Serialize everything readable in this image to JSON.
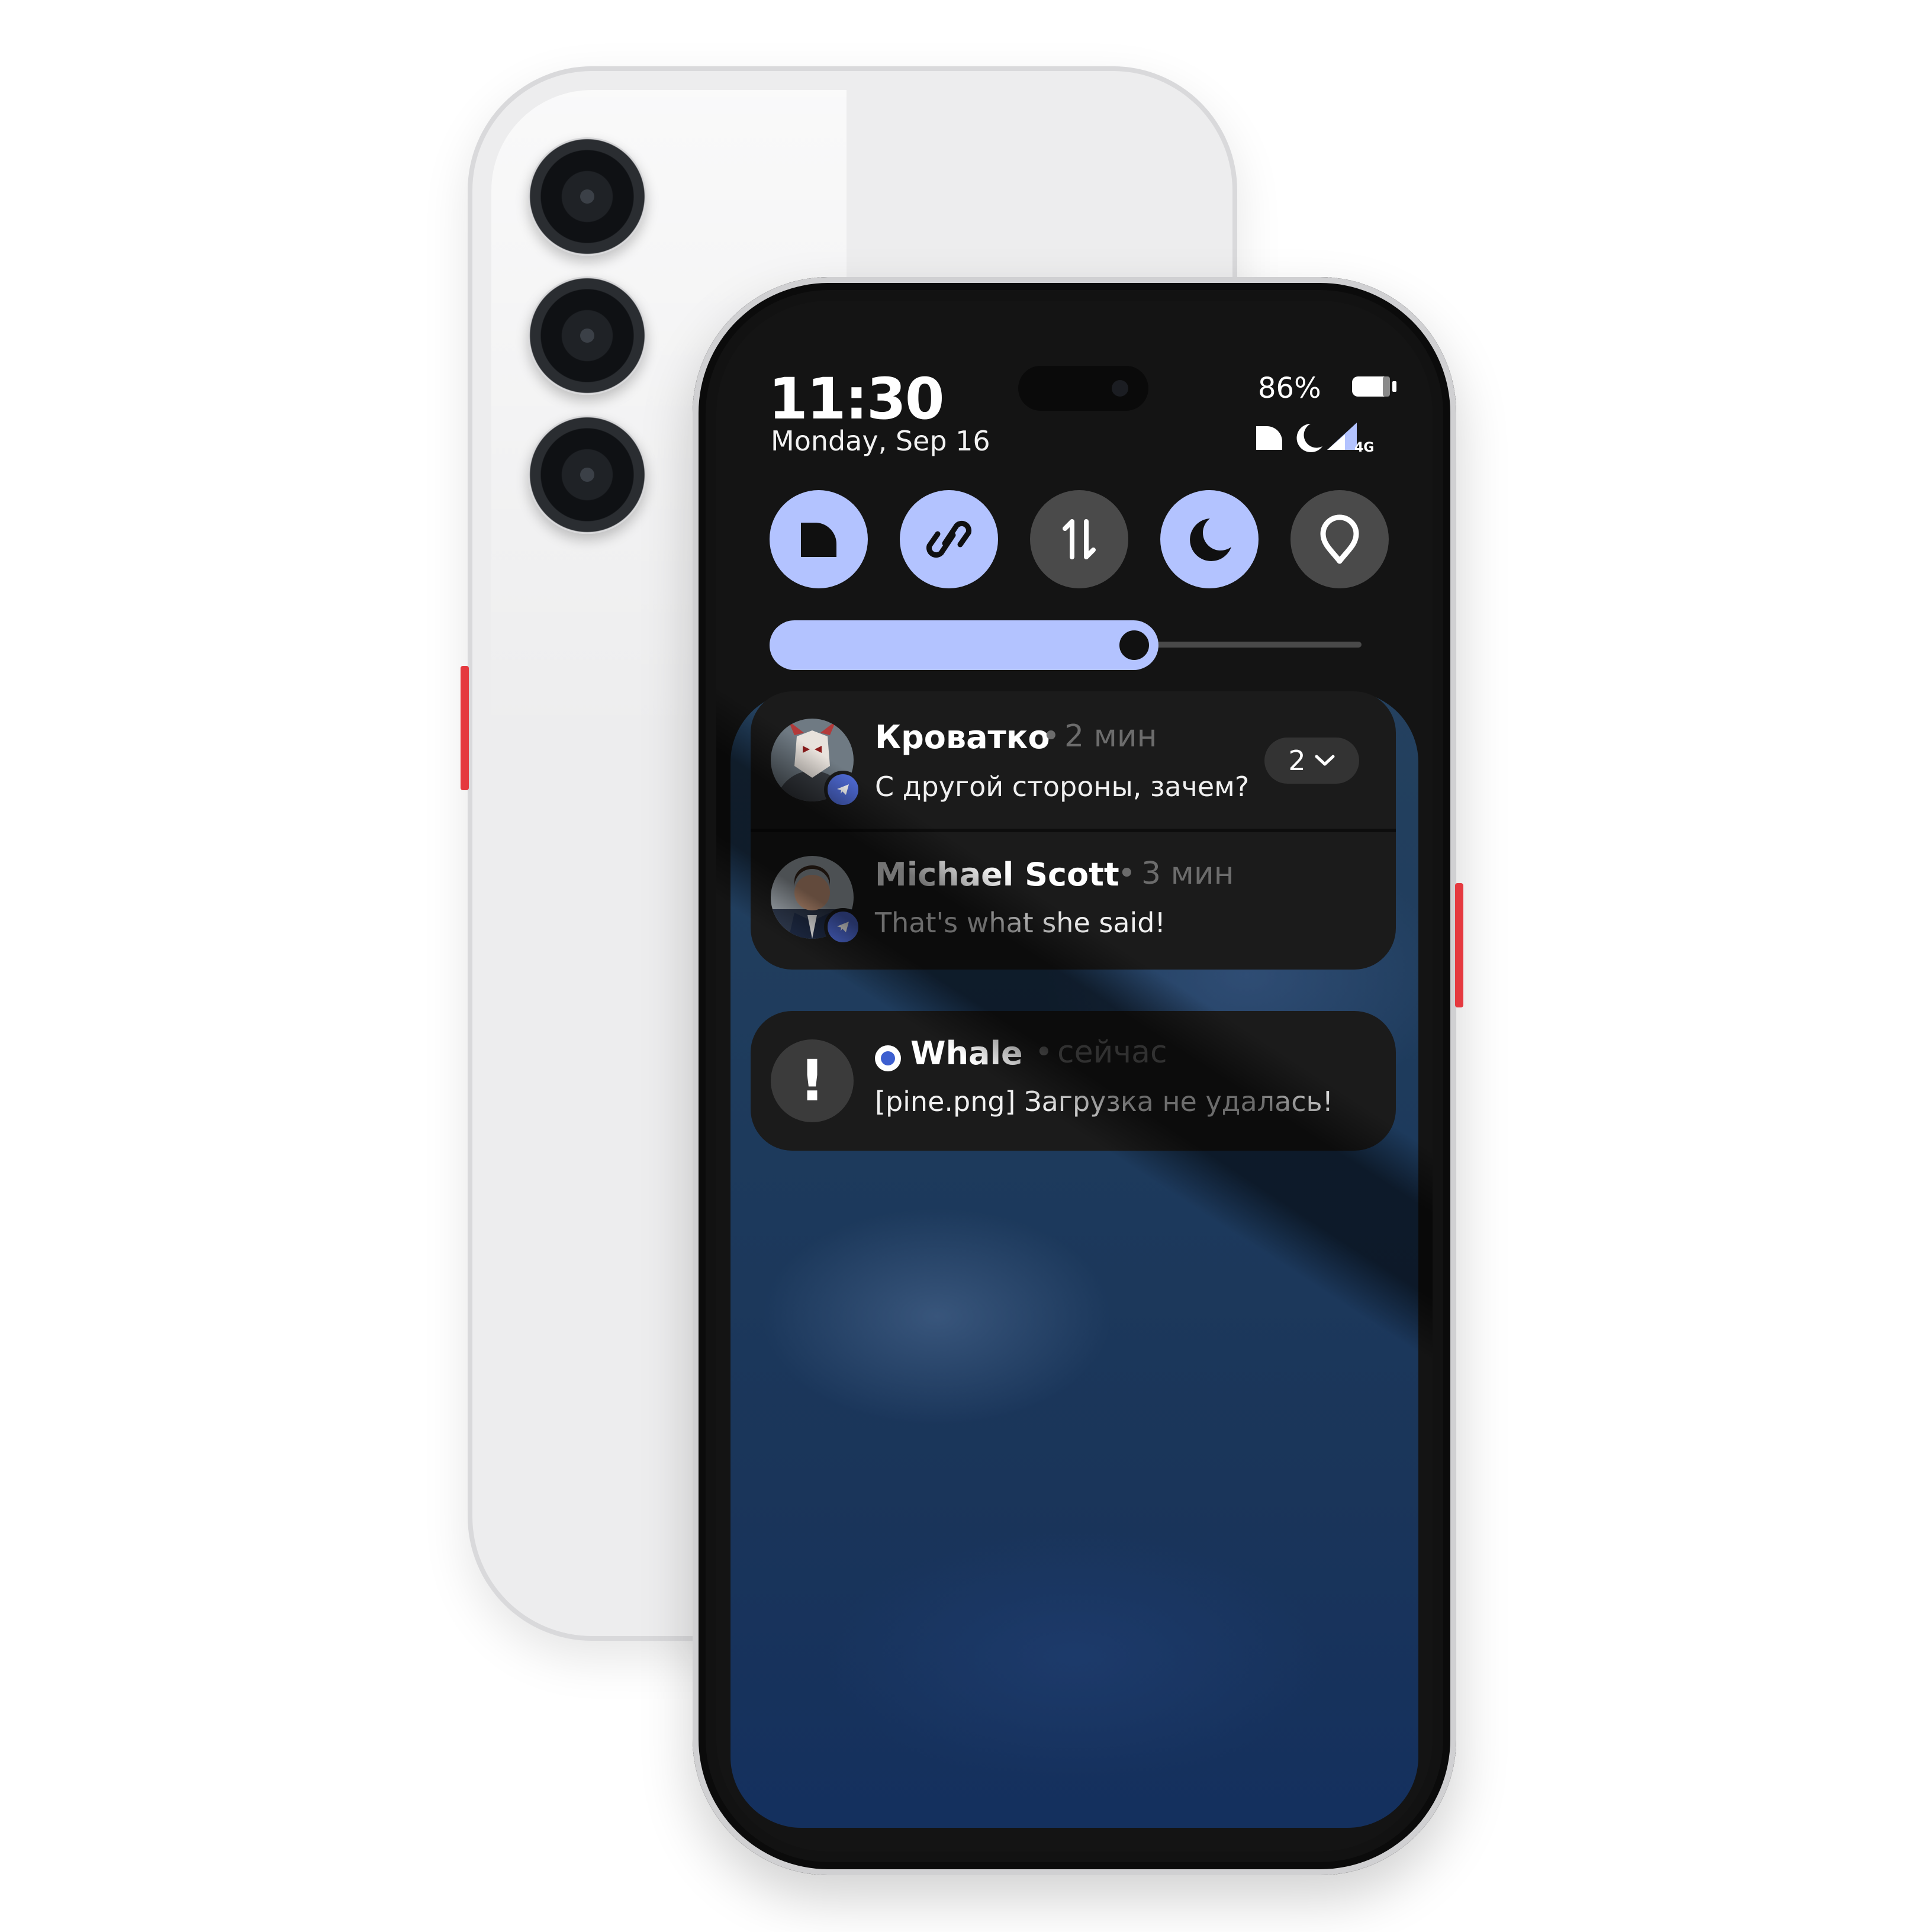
{
  "status_bar": {
    "time": "11:30",
    "date": "Monday, Sep 16",
    "battery_percent": "86%",
    "network_label": "4G",
    "icons": [
      "data-saver-icon",
      "dark-mode-icon",
      "signal-icon"
    ]
  },
  "quick_settings": {
    "tiles": [
      {
        "name": "data-saver",
        "icon": "data-saver-icon",
        "active": true
      },
      {
        "name": "link",
        "icon": "link-icon",
        "active": true
      },
      {
        "name": "mobile-data",
        "icon": "data-transfer-icon",
        "active": false
      },
      {
        "name": "dark-mode",
        "icon": "moon-icon",
        "active": true
      },
      {
        "name": "location",
        "icon": "location-pin-icon",
        "active": false
      }
    ],
    "brightness_level": 0.67
  },
  "notifications": {
    "group": [
      {
        "sender": "Кроватко",
        "separator": "•",
        "time": "2 мин",
        "message": "С другой стороны, зачем?",
        "count": "2",
        "app_icon": "telegram-icon"
      },
      {
        "sender": "Michael Scott",
        "separator": "•",
        "time": "3 мин",
        "message": "That's what she said!",
        "app_icon": "telegram-icon"
      }
    ],
    "single": {
      "app": "Whale",
      "separator": "•",
      "time": "сейчас",
      "message": "[pine.png] Загрузка не удалась!",
      "icon": "exclamation-icon"
    }
  },
  "colors": {
    "accent": "#b3c3ff",
    "tile_off": "#4a4a4a",
    "card_bg": "#1b1b1b",
    "telegram_badge": "#4f6bd6",
    "side_button": "#e5393f"
  }
}
